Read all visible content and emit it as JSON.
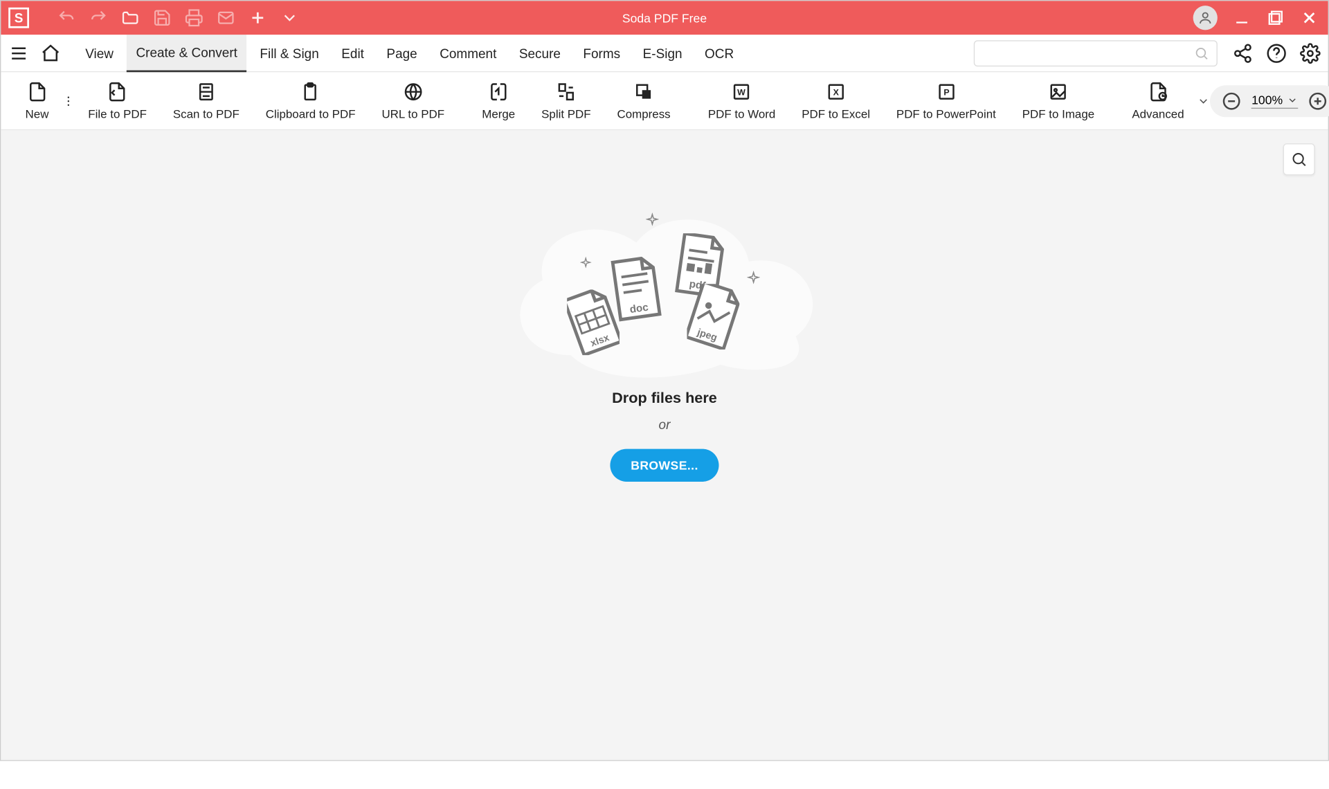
{
  "titlebar": {
    "app_title": "Soda PDF Free",
    "logo_letter": "S"
  },
  "menubar": {
    "items": [
      {
        "label": "View",
        "active": false
      },
      {
        "label": "Create & Convert",
        "active": true
      },
      {
        "label": "Fill & Sign",
        "active": false
      },
      {
        "label": "Edit",
        "active": false
      },
      {
        "label": "Page",
        "active": false
      },
      {
        "label": "Comment",
        "active": false
      },
      {
        "label": "Secure",
        "active": false
      },
      {
        "label": "Forms",
        "active": false
      },
      {
        "label": "E-Sign",
        "active": false
      },
      {
        "label": "OCR",
        "active": false
      }
    ],
    "search_placeholder": ""
  },
  "toolbar": {
    "tools": {
      "new": "New",
      "file_to_pdf": "File to PDF",
      "scan_to_pdf": "Scan to PDF",
      "clipboard_to_pdf": "Clipboard to PDF",
      "url_to_pdf": "URL to PDF",
      "merge": "Merge",
      "split_pdf": "Split PDF",
      "compress": "Compress",
      "pdf_to_word": "PDF to Word",
      "pdf_to_excel": "PDF to Excel",
      "pdf_to_powerpoint": "PDF to PowerPoint",
      "pdf_to_image": "PDF to Image",
      "advanced": "Advanced"
    },
    "zoom_value": "100%"
  },
  "workspace": {
    "drop_text": "Drop files here",
    "or_text": "or",
    "browse_label": "BROWSE..."
  }
}
